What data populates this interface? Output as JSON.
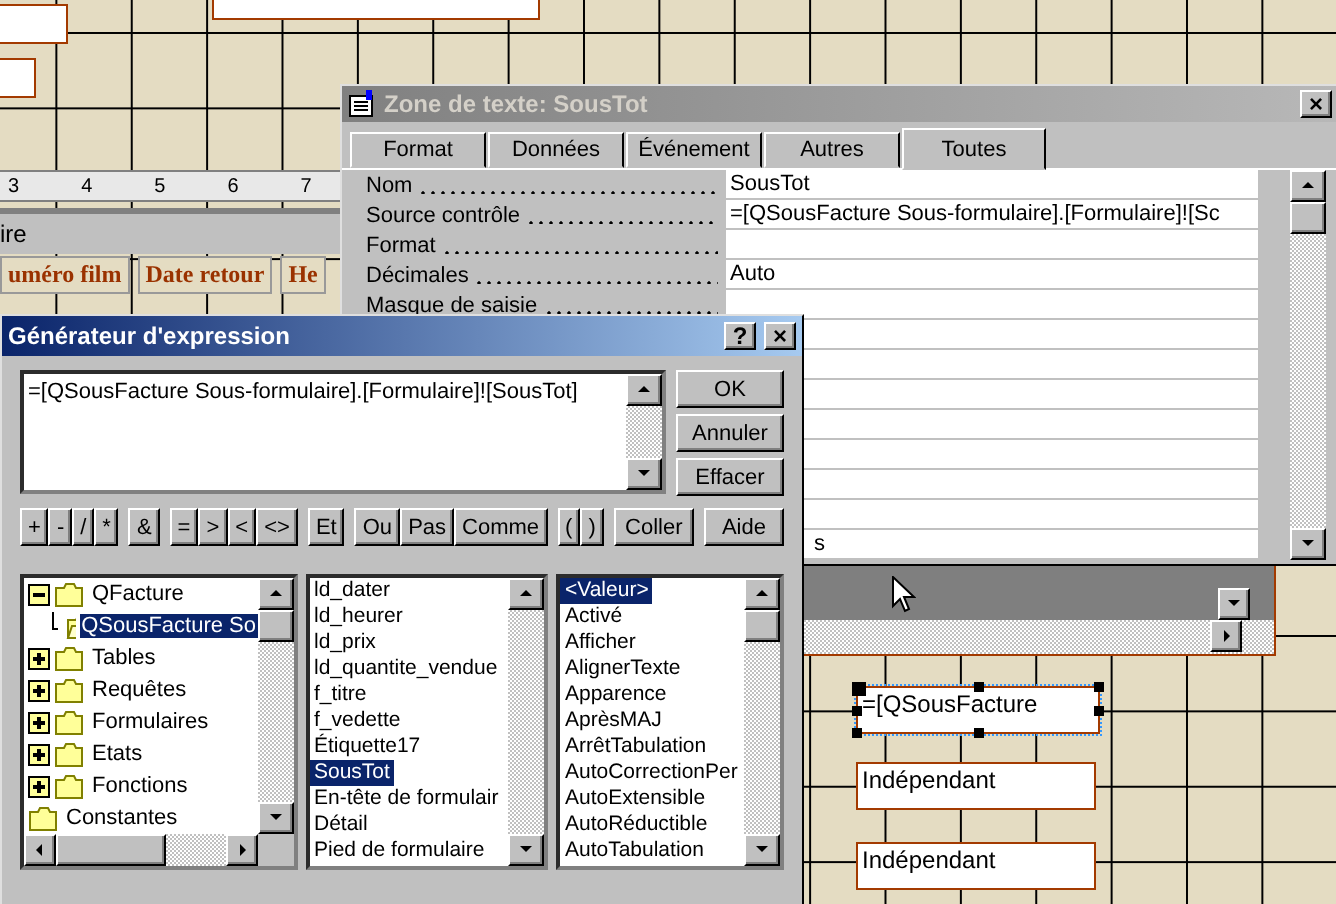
{
  "designer": {
    "ruler_labels": [
      "3",
      "4",
      "5",
      "6",
      "7"
    ],
    "section_bar": "ire",
    "labels": [
      "uméro film",
      "Date retour",
      "He"
    ],
    "text_boxes": [
      {
        "value": "=[QSousFacture",
        "selected": true
      },
      {
        "value": "Indépendant",
        "selected": false
      },
      {
        "value": "Indépendant",
        "selected": false
      }
    ]
  },
  "properties_window": {
    "title": "Zone de texte: SousTot",
    "tabs": [
      {
        "label": "Format",
        "selected": false
      },
      {
        "label": "Données",
        "selected": false
      },
      {
        "label": "Événement",
        "selected": false
      },
      {
        "label": "Autres",
        "selected": false
      },
      {
        "label": "Toutes",
        "selected": true
      }
    ],
    "rows": [
      {
        "label": "Nom",
        "value": "SousTot"
      },
      {
        "label": "Source contrôle",
        "value": "=[QSousFacture Sous-formulaire].[Formulaire]![Sc"
      },
      {
        "label": "Format"
      },
      {
        "label": "Décimales",
        "value": "Auto"
      },
      {
        "label": "Masque de saisie"
      },
      {
        "value": "s"
      }
    ]
  },
  "expression_builder": {
    "title": "Générateur d'expression",
    "help_button": "?",
    "close_button": "×",
    "expression": "=[QSousFacture Sous-formulaire].[Formulaire]![SousTot]",
    "side_buttons": [
      "OK",
      "Annuler",
      "Effacer"
    ],
    "operator_groups": [
      [
        "+",
        "-",
        "/",
        "*"
      ],
      [
        "&"
      ],
      [
        "=",
        ">",
        "<",
        "<>"
      ],
      [
        "Et"
      ],
      [
        "Ou",
        "Pas",
        "Comme"
      ],
      [
        "(",
        ")"
      ]
    ],
    "action_buttons": [
      "Coller",
      "Aide"
    ],
    "tree": [
      {
        "label": "QFacture",
        "kind": "expandable",
        "expanded": true,
        "selected": false,
        "children": [
          {
            "label": "QSousFacture So",
            "kind": "open",
            "selected": true
          }
        ]
      },
      {
        "label": "Tables",
        "kind": "expandable",
        "expanded": false,
        "selected": false
      },
      {
        "label": "Requêtes",
        "kind": "expandable",
        "expanded": false,
        "selected": false
      },
      {
        "label": "Formulaires",
        "kind": "expandable",
        "expanded": false,
        "selected": false
      },
      {
        "label": "Etats",
        "kind": "expandable",
        "expanded": false,
        "selected": false
      },
      {
        "label": "Fonctions",
        "kind": "expandable",
        "expanded": false,
        "selected": false
      },
      {
        "label": "Constantes",
        "kind": "leaf",
        "selected": false
      }
    ],
    "fields": [
      {
        "label": "ld_dater",
        "selected": false
      },
      {
        "label": "ld_heurer",
        "selected": false
      },
      {
        "label": "ld_prix",
        "selected": false
      },
      {
        "label": "ld_quantite_vendue",
        "selected": false
      },
      {
        "label": "f_titre",
        "selected": false
      },
      {
        "label": "f_vedette",
        "selected": false
      },
      {
        "label": "Étiquette17",
        "selected": false
      },
      {
        "label": "SousTot",
        "selected": true
      },
      {
        "label": "En-tête de formulair",
        "selected": false
      },
      {
        "label": "Détail",
        "selected": false
      },
      {
        "label": "Pied de formulaire",
        "selected": false
      }
    ],
    "values": [
      {
        "label": "<Valeur>",
        "selected": true
      },
      {
        "label": "Activé",
        "selected": false
      },
      {
        "label": "Afficher",
        "selected": false
      },
      {
        "label": "AlignerTexte",
        "selected": false
      },
      {
        "label": "Apparence",
        "selected": false
      },
      {
        "label": "AprèsMAJ",
        "selected": false
      },
      {
        "label": "ArrêtTabulation",
        "selected": false
      },
      {
        "label": "AutoCorrectionPer",
        "selected": false
      },
      {
        "label": "AutoExtensible",
        "selected": false
      },
      {
        "label": "AutoRéductible",
        "selected": false
      },
      {
        "label": "AutoTabulation",
        "selected": false
      }
    ]
  }
}
